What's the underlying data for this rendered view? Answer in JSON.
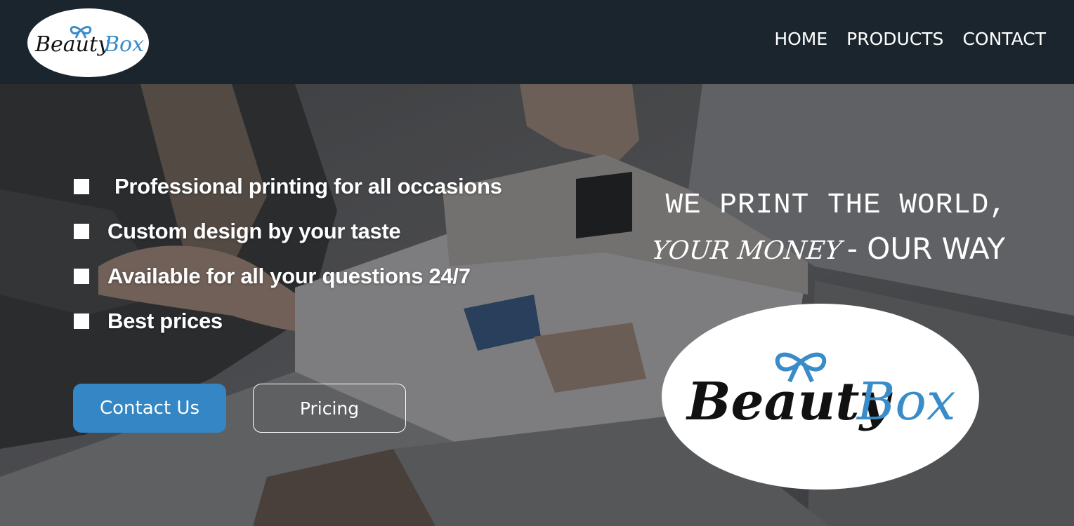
{
  "brand": {
    "word1": "Beauty",
    "word2": "Box",
    "word1_color": "#111111",
    "word2_color": "#3a8cc9",
    "bow_color": "#3a8cc9",
    "logo_icon": "bow-icon"
  },
  "nav": {
    "links": [
      "HOME",
      "PRODUCTS",
      "CONTACT"
    ]
  },
  "hero": {
    "features": [
      "Professional printing for all occasions",
      "Custom design by your taste",
      "Available for all your questions 24/7",
      "Best prices"
    ],
    "buttons": {
      "contact": "Contact Us",
      "pricing": "Pricing"
    },
    "tagline": {
      "line1": "WE PRINT THE WORLD,",
      "line2_accent": "YOUR MONEY",
      "line2_rest": "- OUR WAY"
    }
  },
  "colors": {
    "navbar": "#1b252d",
    "primary_button": "#3486c4",
    "text": "#ffffff"
  }
}
